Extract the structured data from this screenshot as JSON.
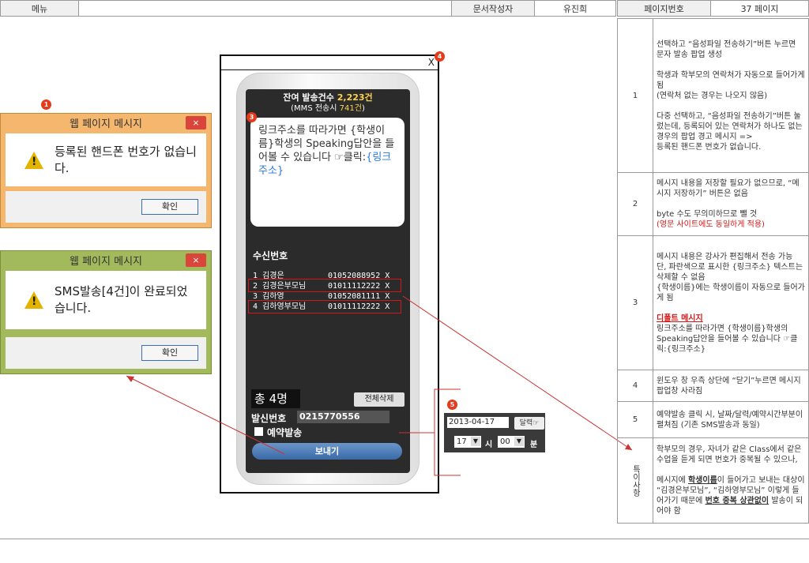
{
  "header": {
    "menu_label": "메뉴",
    "author_label": "문서작성자",
    "author_name": "유진희",
    "page_label": "페이지번호",
    "page_value": "37 페이지"
  },
  "dialog1": {
    "title": "웹 페이지 메시지",
    "close": "×",
    "message": "등록된 핸드폰 번호가 없습니다.",
    "ok": "확인"
  },
  "dialog2": {
    "title": "웹 페이지 메시지",
    "close": "×",
    "message": "SMS발송[4건]이 완료되었습니다.",
    "ok": "확인"
  },
  "phone": {
    "close": "X",
    "remaining_label": "잔여 발송건수",
    "remaining_value": "2,223건",
    "mms_note_prefix": "(MMS 전송시",
    "mms_note_value": "741건",
    "mms_note_suffix": ")",
    "message_text": "링크주소를 따라가면 {학생이름}학생의 Speaking답안을 들어볼 수 있습니다 ☞클릭:",
    "message_link": "{링크주소}",
    "recipients_label": "수신번호",
    "recipients": [
      {
        "name": "1 김경은",
        "number": "01052088952 X"
      },
      {
        "name": "2 김경은부모님",
        "number": "01011112222 X"
      },
      {
        "name": "3 김하영",
        "number": "01052081111 X"
      },
      {
        "name": "4 김하영부모님",
        "number": "01011112222 X"
      }
    ],
    "total": "총 4명",
    "delete_all": "전체삭제",
    "sender_label": "발신번호",
    "sender_number": "0215770556",
    "reserve_label": "예약발송",
    "send_button": "보내기"
  },
  "reservation": {
    "date": "2013-04-17",
    "calendar_button": "달력☞",
    "hour": "17",
    "hour_label": "시",
    "minute": "00",
    "minute_label": "분"
  },
  "badges": [
    "1",
    "3",
    "4",
    "5"
  ],
  "notes": [
    {
      "num": "1",
      "lines": [
        "선택하고 “음성파일 전송하기”버튼 누르면 문자 발송 팝업 생성",
        "",
        "학생과 학부모의 연락처가 자동으로 들어가게 됨",
        "(연락처 없는 경우는 나오지 않음)",
        "",
        "다중 선택하고, “음성파일 전송하기”버튼 눌렀는데, 등록되어 있는 연락처가 하나도 없는 경우의 팝업 경고 메시지 =>",
        "등록된 핸드폰 번호가 없습니다."
      ]
    },
    {
      "num": "2",
      "lines": [
        "메시지 내용을 저장할 필요가 없으므로, “메시지 저장하기” 버튼은 없음",
        "",
        "byte 수도 무의미하므로 뺄 것"
      ],
      "red": "(영문 사이트에도 동일하게 적용)"
    },
    {
      "num": "3",
      "lines": [
        "메시지 내용은 강사가 편집해서 전송 가능",
        "단, 파란색으로 표시한 {링크주소} 텍스트는 삭제할 수 없음",
        "{학생이름}에는 학생이름이 자동으로 들어가게 됨"
      ],
      "red_title": "디폴트 메시지",
      "tail": "링크주소를 따라가면 {학생이름}학생의 Speaking답안을 들어볼 수 있습니다 ☞클릭:{링크주소}"
    },
    {
      "num": "4",
      "lines": [
        "윈도우 창 우측 상단에 “닫기”누르면 메시지 팝업창 사라짐"
      ]
    },
    {
      "num": "5",
      "lines": [
        "예약발송 클릭 시, 날짜/달력/예약시간부분이 펼쳐짐 (기존 SMS발송과 동일)"
      ]
    }
  ],
  "special": {
    "label": "특이사항",
    "line1": "학부모의 경우, 자녀가 같은 Class에서 같은 수업을 듣게 되면 번호가 중복될 수 있으나,",
    "line2a": "메시지에 ",
    "line2b": "학생이름",
    "line2c": "이 들어가고 보내는 대상이 “김경은부모님”, “김하영부모님” 이렇게 들어가기 때문에 ",
    "line2d": "번호 중복 상관없이",
    "line2e": " 발송이 되어야 함"
  }
}
